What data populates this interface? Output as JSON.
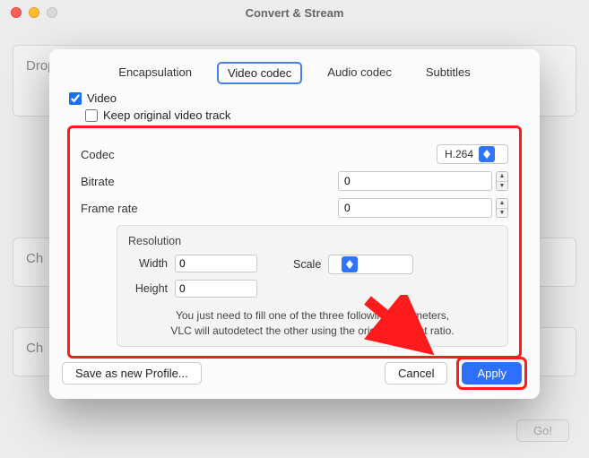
{
  "window": {
    "title": "Convert & Stream",
    "drop_text": "Drop media in here",
    "choose_label": "Ch",
    "go_label": "Go!"
  },
  "sheet": {
    "tabs": {
      "encapsulation": "Encapsulation",
      "video_codec": "Video codec",
      "audio_codec": "Audio codec",
      "subtitles": "Subtitles"
    },
    "video_enable": "Video",
    "keep_original": "Keep original video track",
    "codec_label": "Codec",
    "codec_value": "H.264",
    "bitrate_label": "Bitrate",
    "bitrate_value": "0",
    "framerate_label": "Frame rate",
    "framerate_value": "0",
    "resolution": {
      "title": "Resolution",
      "width_label": "Width",
      "width_value": "0",
      "height_label": "Height",
      "height_value": "0",
      "scale_label": "Scale",
      "scale_value": ""
    },
    "hint": "You just need to fill one of the three following parameters, VLC will autodetect the other using the original aspect ratio.",
    "buttons": {
      "save_profile": "Save as new Profile...",
      "cancel": "Cancel",
      "apply": "Apply"
    }
  }
}
